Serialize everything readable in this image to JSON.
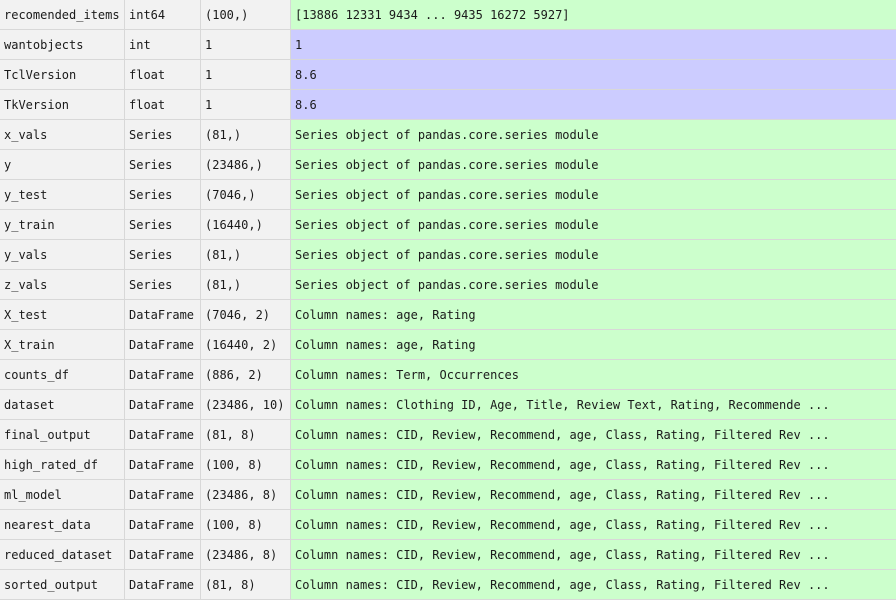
{
  "rows": [
    {
      "name": "recomended_items",
      "type": "int64",
      "size": "(100,)",
      "value": "[13886 12331  9434 ...  9435 16272  5927]",
      "color": "green"
    },
    {
      "name": "wantobjects",
      "type": "int",
      "size": "1",
      "value": "1",
      "color": "blue"
    },
    {
      "name": "TclVersion",
      "type": "float",
      "size": "1",
      "value": "8.6",
      "color": "blue"
    },
    {
      "name": "TkVersion",
      "type": "float",
      "size": "1",
      "value": "8.6",
      "color": "blue"
    },
    {
      "name": "x_vals",
      "type": "Series",
      "size": "(81,)",
      "value": "Series object of pandas.core.series module",
      "color": "green"
    },
    {
      "name": "y",
      "type": "Series",
      "size": "(23486,)",
      "value": "Series object of pandas.core.series module",
      "color": "green"
    },
    {
      "name": "y_test",
      "type": "Series",
      "size": "(7046,)",
      "value": "Series object of pandas.core.series module",
      "color": "green"
    },
    {
      "name": "y_train",
      "type": "Series",
      "size": "(16440,)",
      "value": "Series object of pandas.core.series module",
      "color": "green"
    },
    {
      "name": "y_vals",
      "type": "Series",
      "size": "(81,)",
      "value": "Series object of pandas.core.series module",
      "color": "green"
    },
    {
      "name": "z_vals",
      "type": "Series",
      "size": "(81,)",
      "value": "Series object of pandas.core.series module",
      "color": "green"
    },
    {
      "name": "X_test",
      "type": "DataFrame",
      "size": "(7046, 2)",
      "value": "Column names: age, Rating",
      "color": "green"
    },
    {
      "name": "X_train",
      "type": "DataFrame",
      "size": "(16440, 2)",
      "value": "Column names: age, Rating",
      "color": "green"
    },
    {
      "name": "counts_df",
      "type": "DataFrame",
      "size": "(886, 2)",
      "value": "Column names: Term, Occurrences",
      "color": "green"
    },
    {
      "name": "dataset",
      "type": "DataFrame",
      "size": "(23486, 10)",
      "value": "Column names: Clothing ID, Age, Title, Review Text, Rating, Recommende ...",
      "color": "green"
    },
    {
      "name": "final_output",
      "type": "DataFrame",
      "size": "(81, 8)",
      "value": "Column names: CID, Review, Recommend, age, Class, Rating, Filtered Rev ...",
      "color": "green"
    },
    {
      "name": "high_rated_df",
      "type": "DataFrame",
      "size": "(100, 8)",
      "value": "Column names: CID, Review, Recommend, age, Class, Rating, Filtered Rev ...",
      "color": "green"
    },
    {
      "name": "ml_model",
      "type": "DataFrame",
      "size": "(23486, 8)",
      "value": "Column names: CID, Review, Recommend, age, Class, Rating, Filtered Rev ...",
      "color": "green"
    },
    {
      "name": "nearest_data",
      "type": "DataFrame",
      "size": "(100, 8)",
      "value": "Column names: CID, Review, Recommend, age, Class, Rating, Filtered Rev ...",
      "color": "green"
    },
    {
      "name": "reduced_dataset",
      "type": "DataFrame",
      "size": "(23486, 8)",
      "value": "Column names: CID, Review, Recommend, age, Class, Rating, Filtered Rev ...",
      "color": "green"
    },
    {
      "name": "sorted_output",
      "type": "DataFrame",
      "size": "(81, 8)",
      "value": "Column names: CID, Review, Recommend, age, Class, Rating, Filtered Rev ...",
      "color": "green"
    }
  ],
  "colors": {
    "green": "#ccffcc",
    "blue": "#ccccff",
    "grey": "#f2f2f2"
  }
}
